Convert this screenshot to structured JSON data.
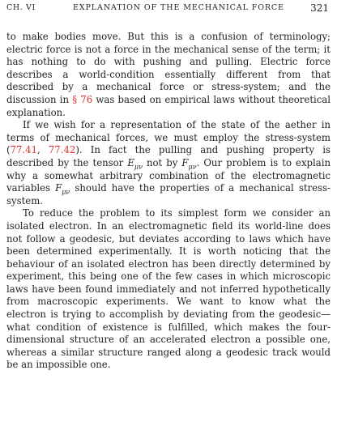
{
  "header": {
    "chapter": "CH. VI",
    "title": "EXPLANATION OF THE MECHANICAL FORCE",
    "page_number": "321"
  },
  "paragraphs": [
    {
      "segments": [
        {
          "type": "text",
          "text": "to make bodies move. But this is a confusion of terminology; electric force is not a force in the mechanical sense of the term; it has nothing to do with pushing and pulling. Electric force describes a world-condition essentially different from that described by a mechanical force or stress-system; and the discussion in "
        },
        {
          "type": "ref",
          "text": "§ 76"
        },
        {
          "type": "text",
          "text": " was based on empirical laws without theoretical explanation."
        }
      ]
    },
    {
      "segments": [
        {
          "type": "text",
          "text": "If we wish for a representation of the state of the aether in terms of mechanical forces, we must employ the stress-system ("
        },
        {
          "type": "ref",
          "text": "77.41"
        },
        {
          "type": "text",
          "text": ", "
        },
        {
          "type": "ref",
          "text": "77.42"
        },
        {
          "type": "text",
          "text": "). In fact the pulling and pushing property is described by the tensor "
        },
        {
          "type": "math",
          "text": "E",
          "sub": "μν"
        },
        {
          "type": "text",
          "text": " not by "
        },
        {
          "type": "math",
          "text": "F",
          "sub": "μν"
        },
        {
          "type": "text",
          "text": ". Our problem is to explain why a somewhat arbitrary combination of the electromagnetic variables "
        },
        {
          "type": "math",
          "text": "F",
          "sub": "μν"
        },
        {
          "type": "text",
          "text": " should have the properties of a mechanical stress-system."
        }
      ]
    },
    {
      "segments": [
        {
          "type": "text",
          "text": "To reduce the problem to its simplest form we consider an isolated electron. In an electromagnetic field its world-line does not follow a geodesic, but deviates according to laws which have been determined experimentally. It is worth noticing that the behaviour of an isolated electron has been directly determined by experiment, this being one of the few cases in which microscopic laws have been found immediately and not inferred hypothetically from macroscopic experiments. We want to know what the electron is trying to accomplish by deviating from the geodesic—what condition of existence is fulfilled, which makes the four-dimensional structure of an accelerated electron a possible one, whereas a similar structure ranged along a geodesic track would be an impossible one."
        }
      ]
    }
  ]
}
